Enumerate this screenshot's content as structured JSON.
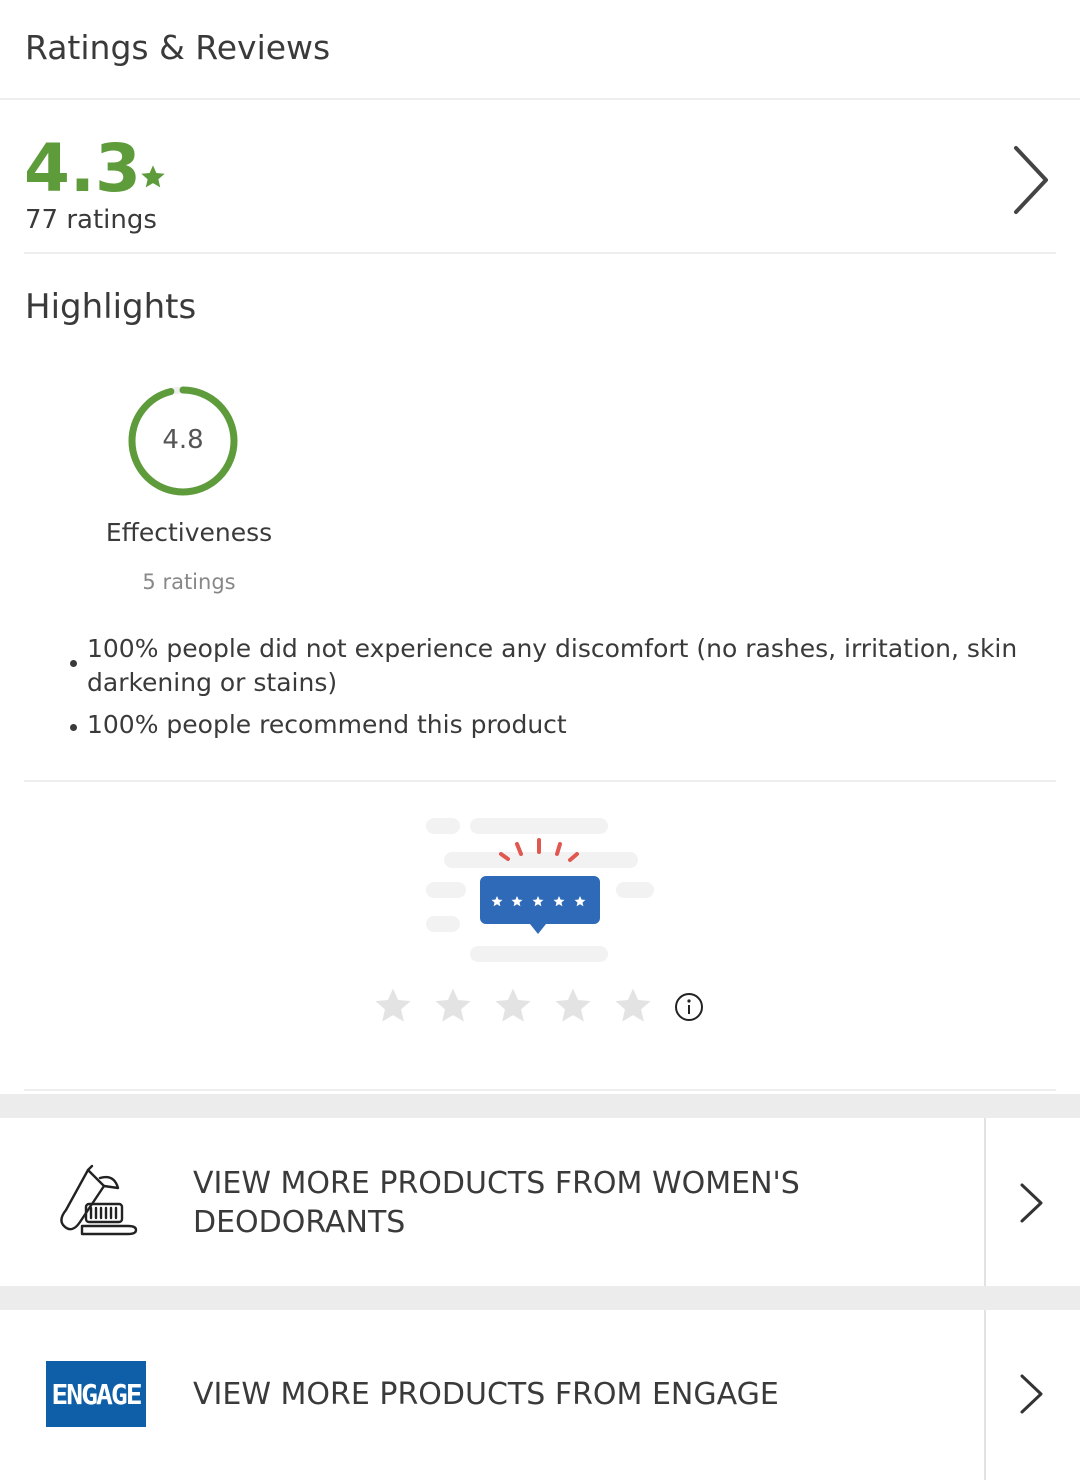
{
  "header": {
    "title": "Ratings & Reviews"
  },
  "summary": {
    "rating": "4.3",
    "ratings_count": "77 ratings"
  },
  "highlights": {
    "title": "Highlights",
    "gauge": {
      "value": "4.8",
      "max": 5,
      "label": "Effectiveness",
      "count": "5 ratings"
    },
    "bullets": [
      "100% people did not experience any discomfort (no rashes, irritation, skin darkening or stains)",
      "100% people recommend this product"
    ]
  },
  "rate": {
    "stars": 5,
    "selected": 0
  },
  "links": [
    {
      "label": "VIEW MORE PRODUCTS FROM WOMEN'S DEODORANTS",
      "icon": "toothbrush-icon"
    },
    {
      "label": "VIEW MORE PRODUCTS FROM ENGAGE",
      "icon": "engage-logo",
      "logo_text": "ENGAGE"
    }
  ],
  "colors": {
    "accent": "#5e9b3b",
    "brand_blue": "#0f5fa8",
    "star_empty": "#e3e3e3",
    "sparkle": "#e0584f"
  }
}
